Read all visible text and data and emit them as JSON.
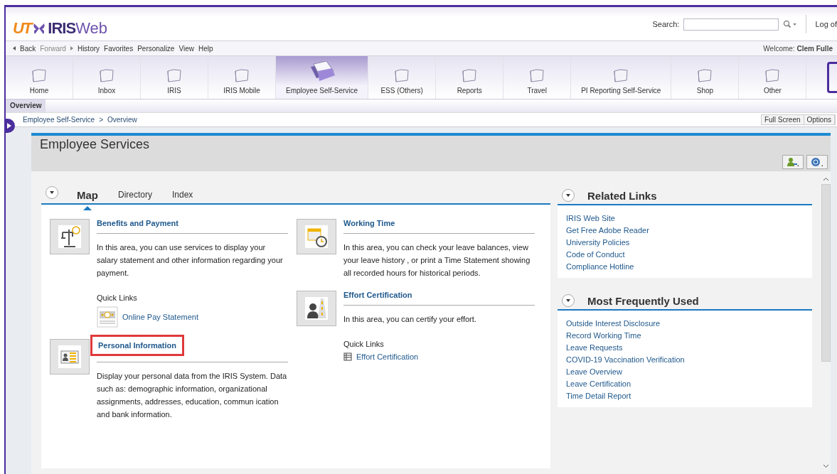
{
  "logo": {
    "mark": "UT",
    "name": "IRIS",
    "suffix": "Web"
  },
  "search": {
    "label": "Search:"
  },
  "logoff": "Log of",
  "menu": [
    {
      "label": "Back",
      "kind": "back",
      "disabled": false
    },
    {
      "label": "Forward",
      "kind": "forward",
      "disabled": true
    },
    {
      "label": "History",
      "kind": "plain",
      "disabled": false
    },
    {
      "label": "Favorites",
      "kind": "plain",
      "disabled": false
    },
    {
      "label": "Personalize",
      "kind": "plain",
      "disabled": false
    },
    {
      "label": "View",
      "kind": "plain",
      "disabled": false
    },
    {
      "label": "Help",
      "kind": "plain",
      "disabled": false
    }
  ],
  "welcome": {
    "label": "Welcome:",
    "name": "Clem Fulle"
  },
  "nav_tabs": [
    {
      "label": "Home",
      "selected": false
    },
    {
      "label": "Inbox",
      "selected": false
    },
    {
      "label": "IRIS",
      "selected": false
    },
    {
      "label": "IRIS Mobile",
      "selected": false
    },
    {
      "label": "Employee Self-Service",
      "selected": true
    },
    {
      "label": "ESS (Others)",
      "selected": false
    },
    {
      "label": "Reports",
      "selected": false
    },
    {
      "label": "Travel",
      "selected": false
    },
    {
      "label": "PI Reporting Self-Service",
      "selected": false
    },
    {
      "label": "Shop",
      "selected": false
    },
    {
      "label": "Other",
      "selected": false
    }
  ],
  "sub_tabs": [
    {
      "label": "Overview",
      "selected": true
    }
  ],
  "breadcrumb": [
    "Employee Self-Service",
    ">",
    "Overview"
  ],
  "page_actions": [
    "Full Screen",
    "Options"
  ],
  "panel": {
    "title": "Employee Services",
    "content_tabs": [
      {
        "label": "Map",
        "selected": true
      },
      {
        "label": "Directory",
        "selected": false
      },
      {
        "label": "Index",
        "selected": false
      }
    ],
    "columns": [
      [
        {
          "title": "Benefits and Payment",
          "kind": "scale",
          "highlighted": false,
          "description": "In this area, you can use services to display your salary statement and other information regarding your payment.",
          "quick_links_label": "Quick Links",
          "quick_links": [
            {
              "label": "Online Pay Statement",
              "kind": "money"
            }
          ]
        },
        {
          "title": "Personal Information",
          "kind": "idcard",
          "highlighted": true,
          "description": "Display your personal data from the IRIS System. Data such as: demographic information, organizational assignments, addresses, education, commun ication and bank information."
        }
      ],
      [
        {
          "title": "Working Time",
          "kind": "calendar",
          "highlighted": false,
          "description": "In this area, you can check your leave balances, view your leave history , or print a Time Statement showing all recorded hours for historical periods."
        },
        {
          "title": "Effort Certification",
          "kind": "road",
          "highlighted": false,
          "description": "In this area, you can certify your effort.",
          "quick_links_label": "Quick Links",
          "quick_links": [
            {
              "label": "Effort Certification",
              "kind": "table"
            }
          ]
        }
      ]
    ]
  },
  "side_panels": [
    {
      "title": "Related Links",
      "expanded": true,
      "links": [
        "IRIS Web Site",
        "Get Free Adobe Reader",
        "University Policies",
        "Code of Conduct",
        "Compliance Hotline"
      ]
    },
    {
      "title": "Most Frequently Used",
      "expanded": true,
      "links": [
        "Outside Interest Disclosure",
        "Record Working Time",
        "Leave Requests",
        "COVID-19 Vaccination Verification",
        "Leave Overview",
        "Leave Certification",
        "Time Detail Report"
      ]
    }
  ]
}
